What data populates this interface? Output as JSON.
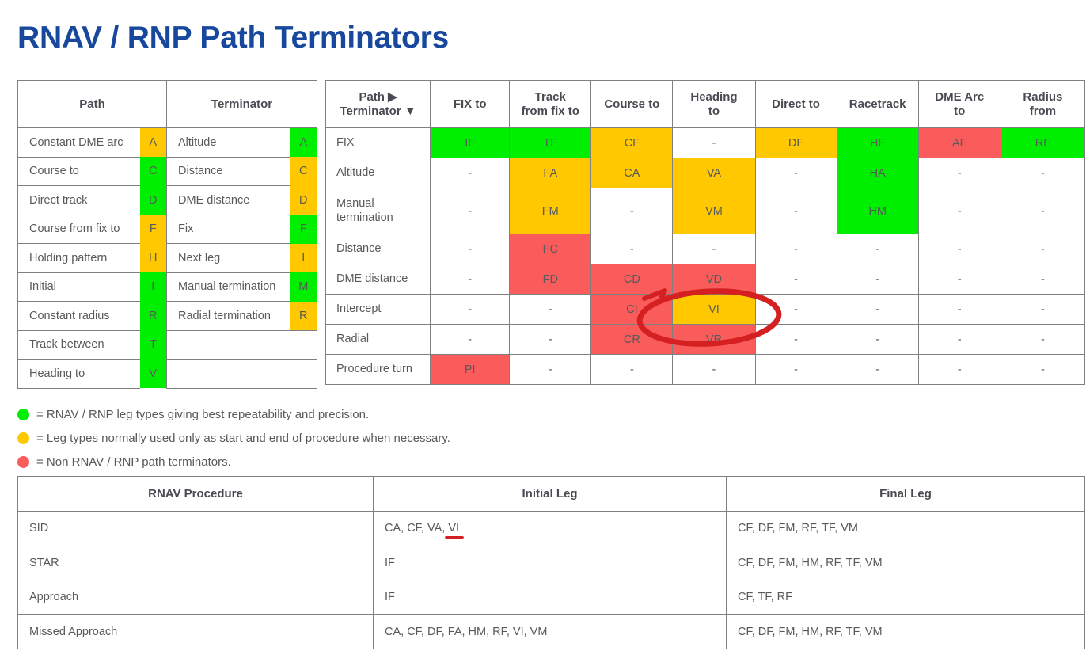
{
  "page": {
    "title": "RNAV / RNP Path Terminators"
  },
  "colors": {
    "title_blue": "#17489E",
    "green": "#00EE00",
    "orange": "#FFC800",
    "red": "#FA5C5C",
    "annotation_red": "#D42020",
    "border": "#808080",
    "text": "#595959"
  },
  "reference_table": {
    "headers": [
      "Path",
      "Terminator"
    ],
    "path_rows": [
      {
        "name": "Constant DME arc",
        "code": "A",
        "color": "orange"
      },
      {
        "name": "Course to",
        "code": "C",
        "color": "green"
      },
      {
        "name": "Direct track",
        "code": "D",
        "color": "green"
      },
      {
        "name": "Course from fix to",
        "code": "F",
        "color": "orange"
      },
      {
        "name": "Holding pattern",
        "code": "H",
        "color": "orange"
      },
      {
        "name": "Initial",
        "code": "I",
        "color": "green"
      },
      {
        "name": "Constant radius",
        "code": "R",
        "color": "green"
      },
      {
        "name": "Track between",
        "code": "T",
        "color": "green"
      },
      {
        "name": "Heading to",
        "code": "V",
        "color": "green"
      }
    ],
    "terminator_rows": [
      {
        "name": "Altitude",
        "code": "A",
        "color": "green"
      },
      {
        "name": "Distance",
        "code": "C",
        "color": "orange"
      },
      {
        "name": "DME distance",
        "code": "D",
        "color": "orange"
      },
      {
        "name": "Fix",
        "code": "F",
        "color": "green"
      },
      {
        "name": "Next leg",
        "code": "I",
        "color": "orange"
      },
      {
        "name": "Manual termination",
        "code": "M",
        "color": "green"
      },
      {
        "name": "Radial termination",
        "code": "R",
        "color": "orange"
      },
      {
        "name": "",
        "code": "",
        "color": "white"
      },
      {
        "name": "",
        "code": "",
        "color": "white"
      }
    ]
  },
  "matrix_table": {
    "corner_header_line1": "Path ▶",
    "corner_header_line2": "Terminator ▼",
    "column_headers": [
      "FIX to",
      "Track\nfrom fix to",
      "Course to",
      "Heading\nto",
      "Direct to",
      "Racetrack",
      "DME Arc\nto",
      "Radius\nfrom"
    ],
    "rows": [
      {
        "label": "FIX",
        "cells": [
          {
            "text": "IF",
            "color": "green"
          },
          {
            "text": "TF",
            "color": "green"
          },
          {
            "text": "CF",
            "color": "orange"
          },
          {
            "text": "-",
            "color": "white"
          },
          {
            "text": "DF",
            "color": "orange"
          },
          {
            "text": "HF",
            "color": "green"
          },
          {
            "text": "AF",
            "color": "red"
          },
          {
            "text": "RF",
            "color": "green"
          }
        ]
      },
      {
        "label": "Altitude",
        "cells": [
          {
            "text": "-",
            "color": "white"
          },
          {
            "text": "FA",
            "color": "orange"
          },
          {
            "text": "CA",
            "color": "orange"
          },
          {
            "text": "VA",
            "color": "orange"
          },
          {
            "text": "-",
            "color": "white"
          },
          {
            "text": "HA",
            "color": "green"
          },
          {
            "text": "-",
            "color": "white"
          },
          {
            "text": "-",
            "color": "white"
          }
        ]
      },
      {
        "label": "Manual\ntermination",
        "cells": [
          {
            "text": "-",
            "color": "white"
          },
          {
            "text": "FM",
            "color": "orange"
          },
          {
            "text": "-",
            "color": "white"
          },
          {
            "text": "VM",
            "color": "orange"
          },
          {
            "text": "-",
            "color": "white"
          },
          {
            "text": "HM",
            "color": "green"
          },
          {
            "text": "-",
            "color": "white"
          },
          {
            "text": "-",
            "color": "white"
          }
        ]
      },
      {
        "label": "Distance",
        "cells": [
          {
            "text": "-",
            "color": "white"
          },
          {
            "text": "FC",
            "color": "red"
          },
          {
            "text": "-",
            "color": "white"
          },
          {
            "text": "-",
            "color": "white"
          },
          {
            "text": "-",
            "color": "white"
          },
          {
            "text": "-",
            "color": "white"
          },
          {
            "text": "-",
            "color": "white"
          },
          {
            "text": "-",
            "color": "white"
          }
        ]
      },
      {
        "label": "DME distance",
        "cells": [
          {
            "text": "-",
            "color": "white"
          },
          {
            "text": "FD",
            "color": "red"
          },
          {
            "text": "CD",
            "color": "red"
          },
          {
            "text": "VD",
            "color": "red"
          },
          {
            "text": "-",
            "color": "white"
          },
          {
            "text": "-",
            "color": "white"
          },
          {
            "text": "-",
            "color": "white"
          },
          {
            "text": "-",
            "color": "white"
          }
        ]
      },
      {
        "label": "Intercept",
        "cells": [
          {
            "text": "-",
            "color": "white"
          },
          {
            "text": "-",
            "color": "white"
          },
          {
            "text": "CI",
            "color": "red"
          },
          {
            "text": "VI",
            "color": "orange"
          },
          {
            "text": "-",
            "color": "white"
          },
          {
            "text": "-",
            "color": "white"
          },
          {
            "text": "-",
            "color": "white"
          },
          {
            "text": "-",
            "color": "white"
          }
        ]
      },
      {
        "label": "Radial",
        "cells": [
          {
            "text": "-",
            "color": "white"
          },
          {
            "text": "-",
            "color": "white"
          },
          {
            "text": "CR",
            "color": "red"
          },
          {
            "text": "VR",
            "color": "red"
          },
          {
            "text": "-",
            "color": "white"
          },
          {
            "text": "-",
            "color": "white"
          },
          {
            "text": "-",
            "color": "white"
          },
          {
            "text": "-",
            "color": "white"
          }
        ]
      },
      {
        "label": "Procedure turn",
        "cells": [
          {
            "text": "PI",
            "color": "red"
          },
          {
            "text": "-",
            "color": "white"
          },
          {
            "text": "-",
            "color": "white"
          },
          {
            "text": "-",
            "color": "white"
          },
          {
            "text": "-",
            "color": "white"
          },
          {
            "text": "-",
            "color": "white"
          },
          {
            "text": "-",
            "color": "white"
          },
          {
            "text": "-",
            "color": "white"
          }
        ]
      }
    ]
  },
  "legend": [
    {
      "color": "green",
      "text": "= RNAV / RNP leg types giving best repeatability and precision."
    },
    {
      "color": "orange",
      "text": "= Leg types normally used only as start and end of procedure when necessary."
    },
    {
      "color": "red",
      "text": "= Non RNAV / RNP path terminators."
    }
  ],
  "procedure_table": {
    "headers": [
      "RNAV Procedure",
      "Initial Leg",
      "Final Leg"
    ],
    "rows": [
      {
        "procedure": "SID",
        "initial_leg": "CA, CF, VA, VI",
        "initial_leg_prefix": "CA, CF, VA, ",
        "initial_leg_underlined": "VI",
        "final_leg": "CF, DF, FM, RF, TF, VM"
      },
      {
        "procedure": "STAR",
        "initial_leg": "IF",
        "final_leg": "CF, DF, FM, HM, RF, TF, VM"
      },
      {
        "procedure": "Approach",
        "initial_leg": "IF",
        "final_leg": "CF, TF, RF"
      },
      {
        "procedure": "Missed Approach",
        "initial_leg": "CA, CF, DF, FA, HM, RF, VI, VM",
        "final_leg": "CF, DF, FM, HM, RF, TF, VM"
      }
    ]
  },
  "annotations": {
    "ellipse_target": "VI",
    "underline_target": "VI"
  }
}
